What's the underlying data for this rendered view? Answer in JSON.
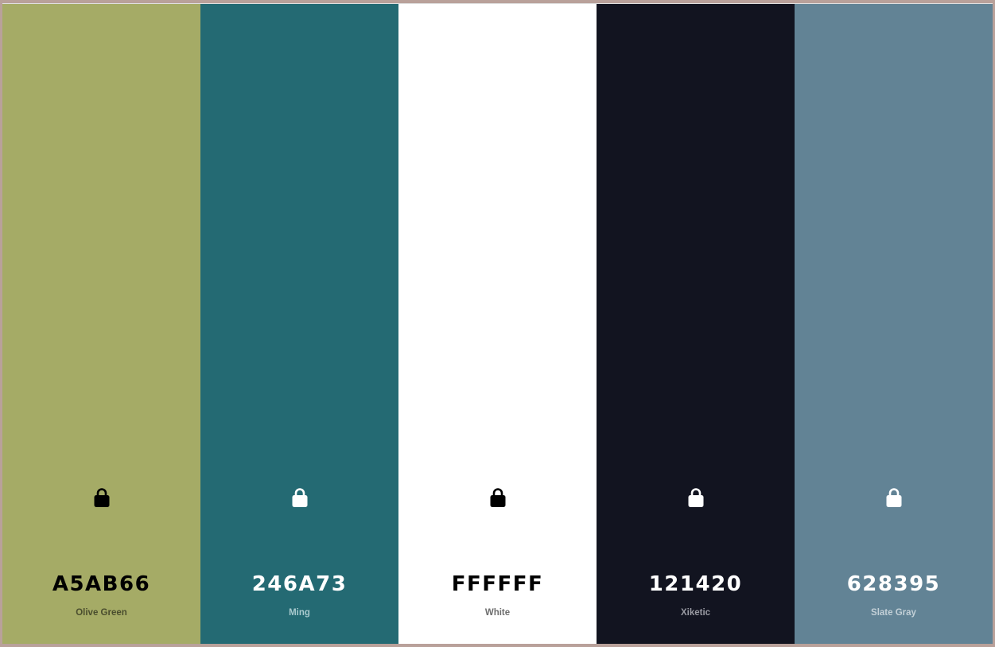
{
  "palette": {
    "colors": [
      {
        "hex": "A5AB66",
        "name": "Olive Green",
        "bg": "#A5AB66",
        "text_color": "#000000",
        "name_color": "#4a4d2e",
        "lock_icon": "lock-icon"
      },
      {
        "hex": "246A73",
        "name": "Ming",
        "bg": "#246A73",
        "text_color": "#ffffff",
        "name_color": "#a9cace",
        "lock_icon": "lock-icon"
      },
      {
        "hex": "FFFFFF",
        "name": "White",
        "bg": "#FFFFFF",
        "text_color": "#000000",
        "name_color": "#6e6e6e",
        "lock_icon": "lock-icon"
      },
      {
        "hex": "121420",
        "name": "Xiketic",
        "bg": "#121420",
        "text_color": "#ffffff",
        "name_color": "#9a9ba3",
        "lock_icon": "lock-icon"
      },
      {
        "hex": "628395",
        "name": "Slate Gray",
        "bg": "#628395",
        "text_color": "#ffffff",
        "name_color": "#c3d0d7",
        "lock_icon": "lock-icon"
      }
    ]
  }
}
